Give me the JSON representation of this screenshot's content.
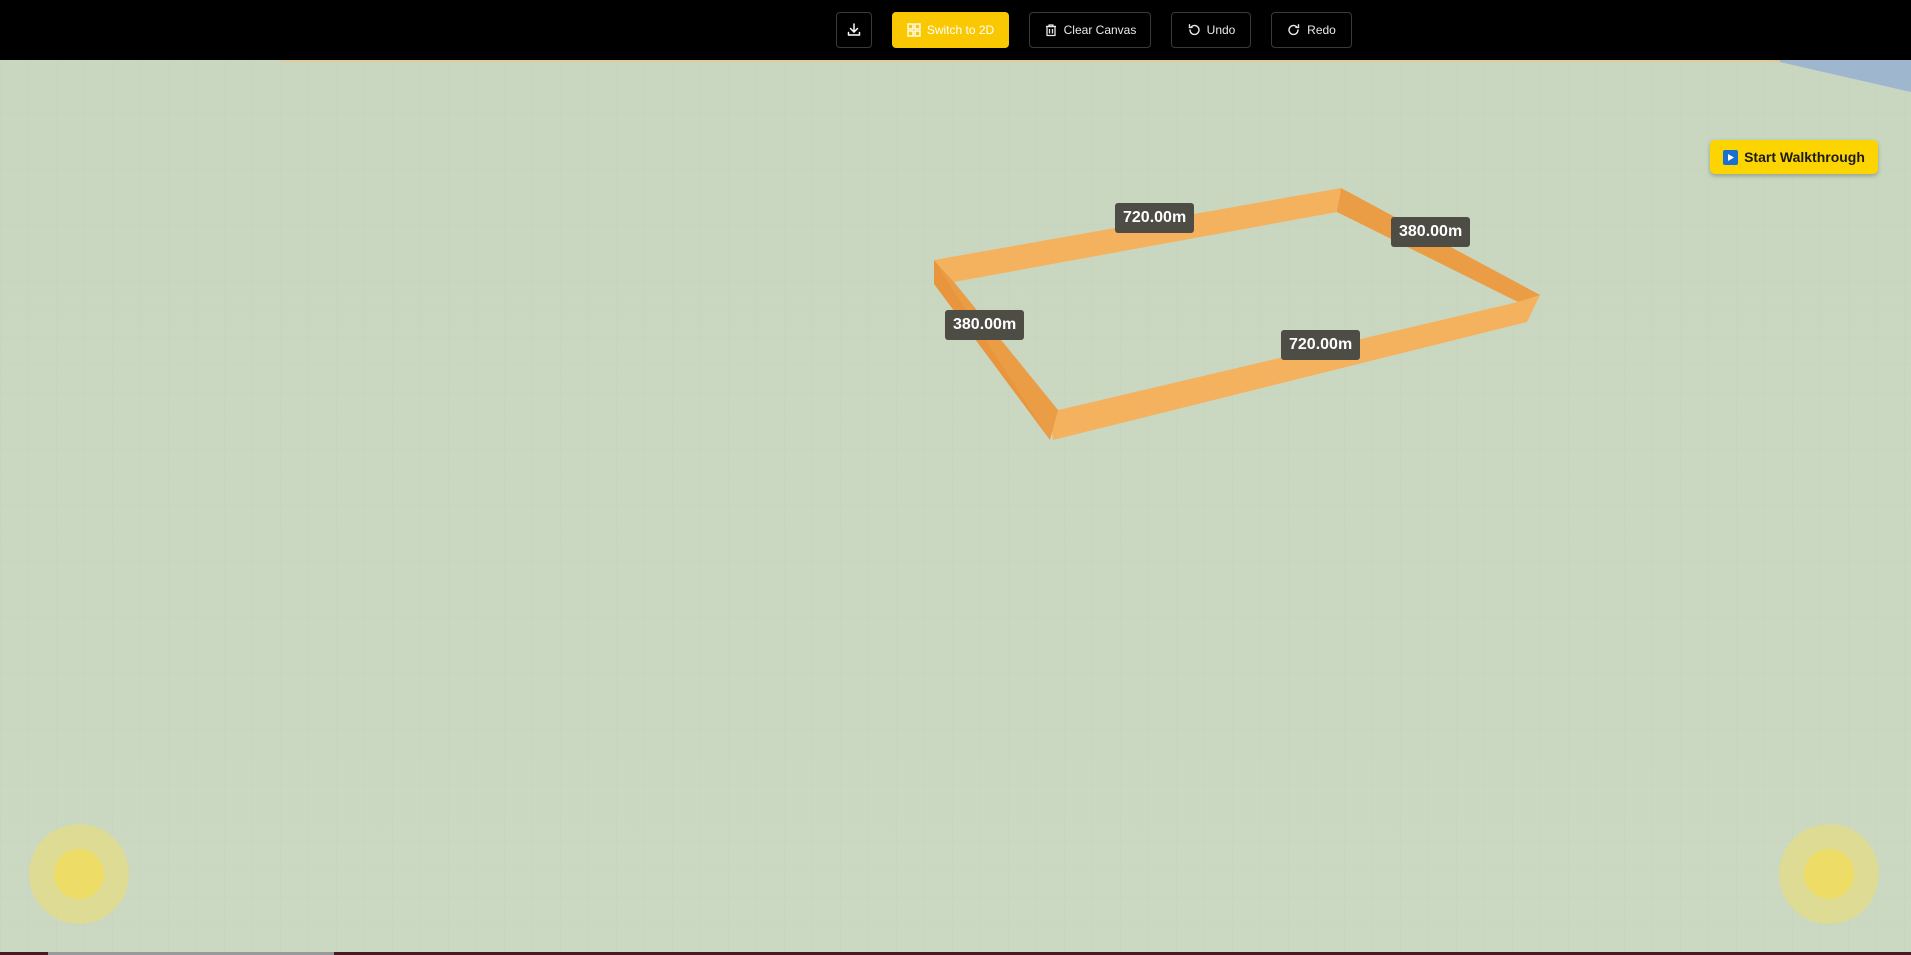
{
  "toolbar": {
    "download_icon": "download-icon",
    "switch_label": "Switch to 2D",
    "switch_icon": "grid-icon",
    "clear_label": "Clear Canvas",
    "clear_icon": "trash-icon",
    "undo_label": "Undo",
    "undo_icon": "undo-icon",
    "redo_label": "Redo",
    "redo_icon": "redo-icon"
  },
  "walkthrough": {
    "label": "Start Walkthrough",
    "icon": "play-icon"
  },
  "walls": {
    "top_length": "720.00m",
    "right_length": "380.00m",
    "left_length": "380.00m",
    "bottom_length": "720.00m"
  },
  "colors": {
    "accent": "#fac800",
    "ground": "#cbd8c2",
    "wall": "#f5b25e",
    "wall_shadow": "#e9953d",
    "label_bg": "#4d4d45",
    "toolbar_bg": "#000000"
  },
  "joysticks": {
    "left_icon": "joystick-left",
    "right_icon": "joystick-right"
  }
}
